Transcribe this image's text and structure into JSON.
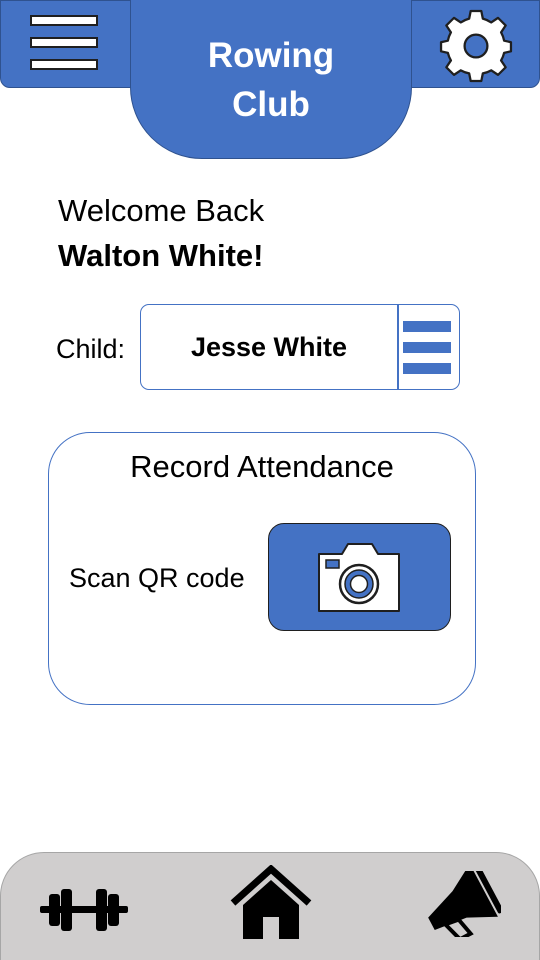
{
  "header": {
    "title": "Rowing Club",
    "menu_icon": "hamburger-menu-icon",
    "settings_icon": "gear-icon",
    "accent": "#4472c4"
  },
  "welcome": {
    "greeting": "Welcome Back",
    "user_name": "Walton White!"
  },
  "child_selector": {
    "label": "Child:",
    "selected": "Jesse White",
    "menu_icon": "list-menu-icon"
  },
  "attendance": {
    "title": "Record Attendance",
    "scan_label": "Scan QR code",
    "camera_icon": "camera-icon"
  },
  "bottom_nav": {
    "items": [
      {
        "name": "workouts",
        "icon": "dumbbell-icon"
      },
      {
        "name": "home",
        "icon": "home-icon"
      },
      {
        "name": "announcements",
        "icon": "megaphone-icon"
      }
    ],
    "background": "#d0cece"
  }
}
